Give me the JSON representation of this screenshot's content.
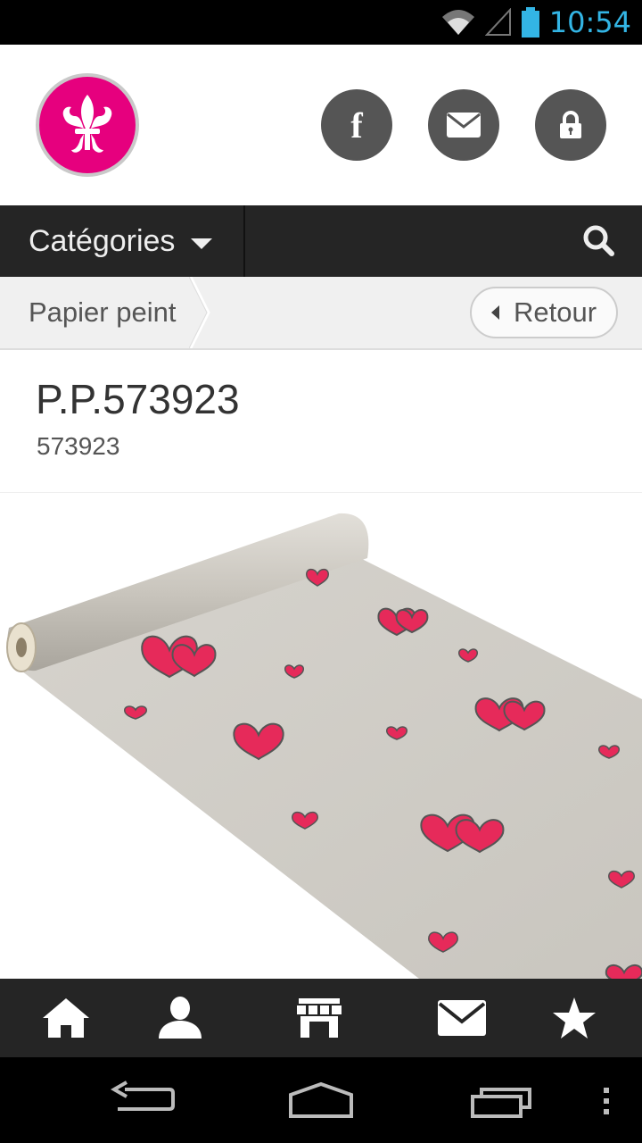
{
  "status_bar": {
    "time": "10:54",
    "icons": [
      "wifi-icon",
      "signal-icon",
      "battery-icon"
    ],
    "accent": "#33b5e5"
  },
  "header": {
    "logo": "fleur-de-lis-logo",
    "brand_color": "#e6007e",
    "actions": [
      {
        "name": "facebook-button",
        "icon": "facebook-icon",
        "label": "f"
      },
      {
        "name": "mail-button",
        "icon": "envelope-icon"
      },
      {
        "name": "login-button",
        "icon": "lock-icon"
      }
    ]
  },
  "navbar": {
    "categories_label": "Catégories",
    "search_icon": "search-icon"
  },
  "breadcrumb": {
    "current": "Papier peint",
    "back_label": "Retour"
  },
  "product": {
    "title": "P.P.573923",
    "reference": "573923",
    "image": "wallpaper-roll-with-red-hearts",
    "expand_icon": "expand-icon"
  },
  "tabbar": {
    "items": [
      "home-icon",
      "user-icon",
      "store-icon",
      "envelope-icon",
      "star-icon"
    ]
  },
  "system_nav": [
    "back-icon",
    "home-icon",
    "recent-apps-icon",
    "overflow-menu-icon"
  ]
}
